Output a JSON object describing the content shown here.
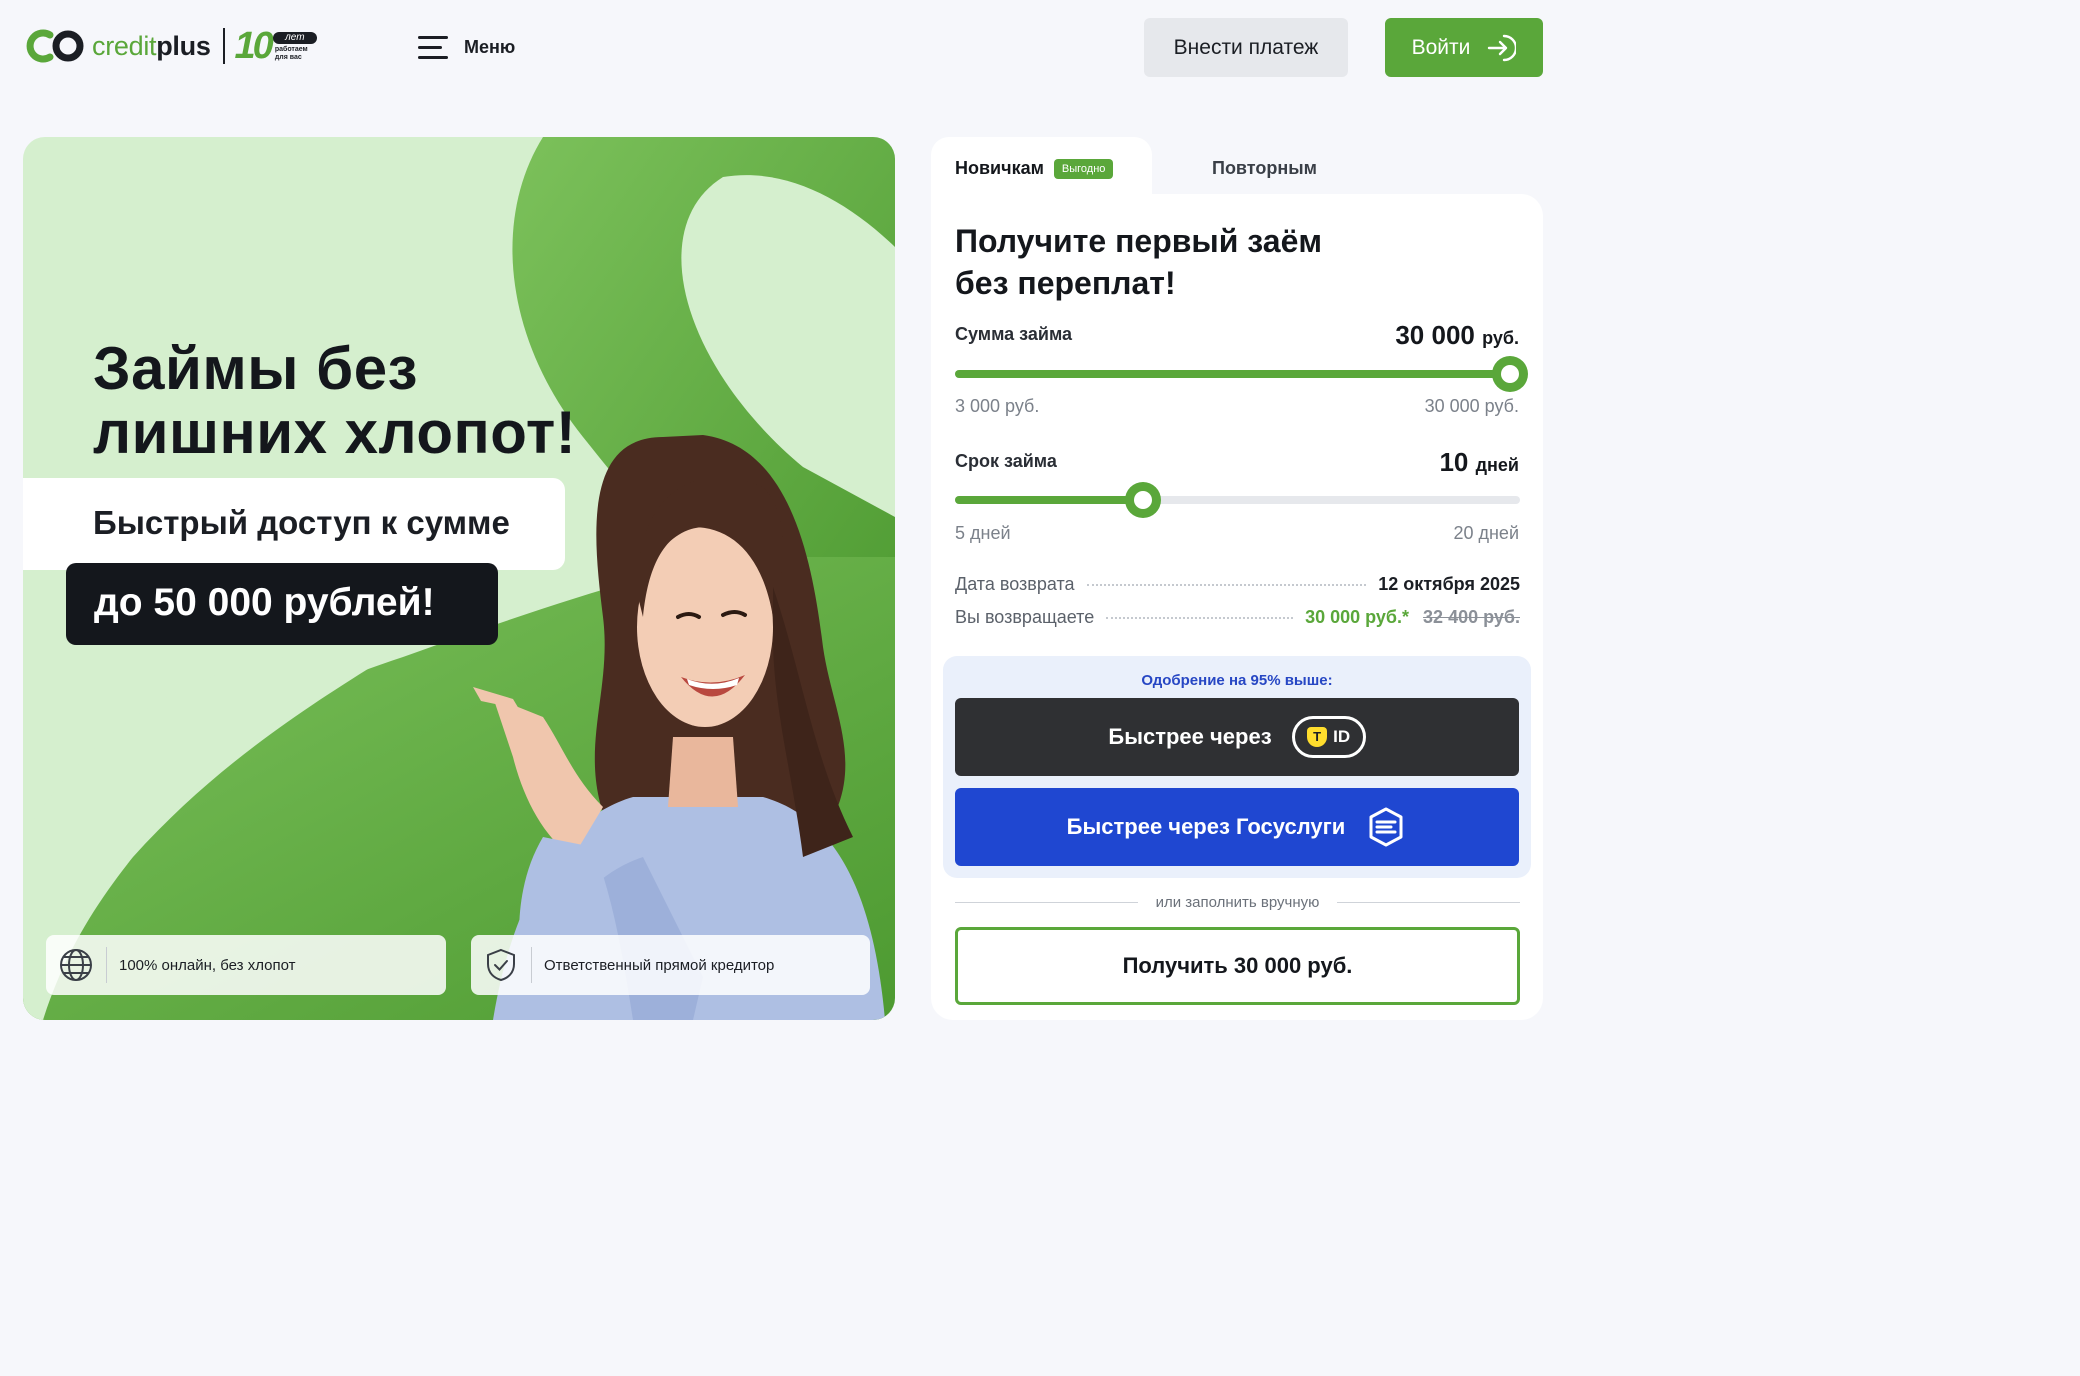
{
  "header": {
    "logo_credit": "credit",
    "logo_plus": "plus",
    "logo_ten": "10",
    "logo_years": "лет",
    "logo_tagline_1": "работаем",
    "logo_tagline_2": "для вас",
    "menu_label": "Меню",
    "pay_button": "Внести платеж",
    "login_button": "Войти"
  },
  "hero": {
    "title_line1": "Займы без",
    "title_line2": "лишних хлопот!",
    "subtitle": "Быстрый доступ к сумме",
    "amount": "до 50 000 рублей!",
    "features": [
      {
        "icon": "globe-icon",
        "text": "100% онлайн, без хлопот"
      },
      {
        "icon": "shield-check-icon",
        "text": "Ответственный прямой кредитор"
      }
    ]
  },
  "calculator": {
    "tabs": [
      {
        "label": "Новичкам",
        "badge": "Выгодно",
        "active": true
      },
      {
        "label": "Повторным",
        "active": false
      }
    ],
    "title_line1": "Получите первый заём",
    "title_line2": "без переплат!",
    "amount": {
      "label": "Сумма займа",
      "value": "30 000",
      "unit": "руб.",
      "min": "3 000 руб.",
      "max": "30 000 руб.",
      "fraction": 1.0
    },
    "term": {
      "label": "Срок займа",
      "value": "10",
      "unit": "дней",
      "min": "5 дней",
      "max": "20 дней",
      "fraction": 0.333
    },
    "return_date_label": "Дата возврата",
    "return_date_value": "12 октября 2025",
    "repay_label": "Вы возвращаете",
    "repay_value": "30 000 руб.*",
    "repay_old": "32 400 руб.",
    "approval_note": "Одобрение на 95% выше:",
    "tid_button": "Быстрее через",
    "tid_badge_letter": "Т",
    "tid_badge_text": "ID",
    "gos_button": "Быстрее через Госуслуги",
    "or_text": "или заполнить вручную",
    "get_button": "Получить 30 000 руб."
  },
  "colors": {
    "brand_green": "#5aa73a",
    "light_green": "#d5efce",
    "dark": "#14171c",
    "gosuslugi_blue": "#1f47d1",
    "tid_dark": "#2f3033"
  }
}
